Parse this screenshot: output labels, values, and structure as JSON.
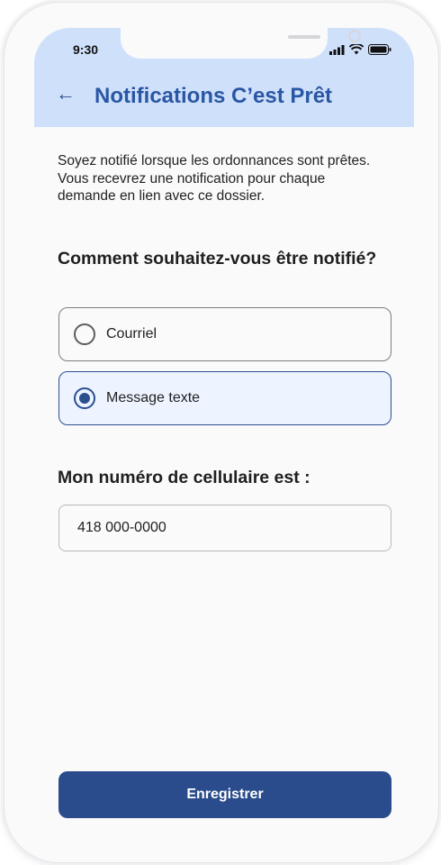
{
  "status_bar": {
    "time": "9:30",
    "icons": [
      "signal-icon",
      "wifi-icon",
      "battery-icon"
    ]
  },
  "header": {
    "back_icon": "arrow-left-icon",
    "back_glyph": "←",
    "title": "Notifications C’est Prêt"
  },
  "intro": {
    "text": "Soyez notifié lorsque les ordonnances sont prêtes. Vous recevrez une notification pour chaque demande en lien avec ce dossier."
  },
  "notification_method": {
    "question": "Comment souhaitez-vous être notifié?",
    "options": [
      {
        "label": "Courriel",
        "selected": false
      },
      {
        "label": "Message texte",
        "selected": true
      }
    ]
  },
  "phone_number": {
    "heading": "Mon numéro de cellulaire est :",
    "value": "418 000-0000"
  },
  "actions": {
    "save_label": "Enregistrer"
  },
  "colors": {
    "header_bg": "#cfe0fb",
    "title": "#2a57a4",
    "primary": "#2a4c8c",
    "selected_bg": "#edf3ff"
  }
}
